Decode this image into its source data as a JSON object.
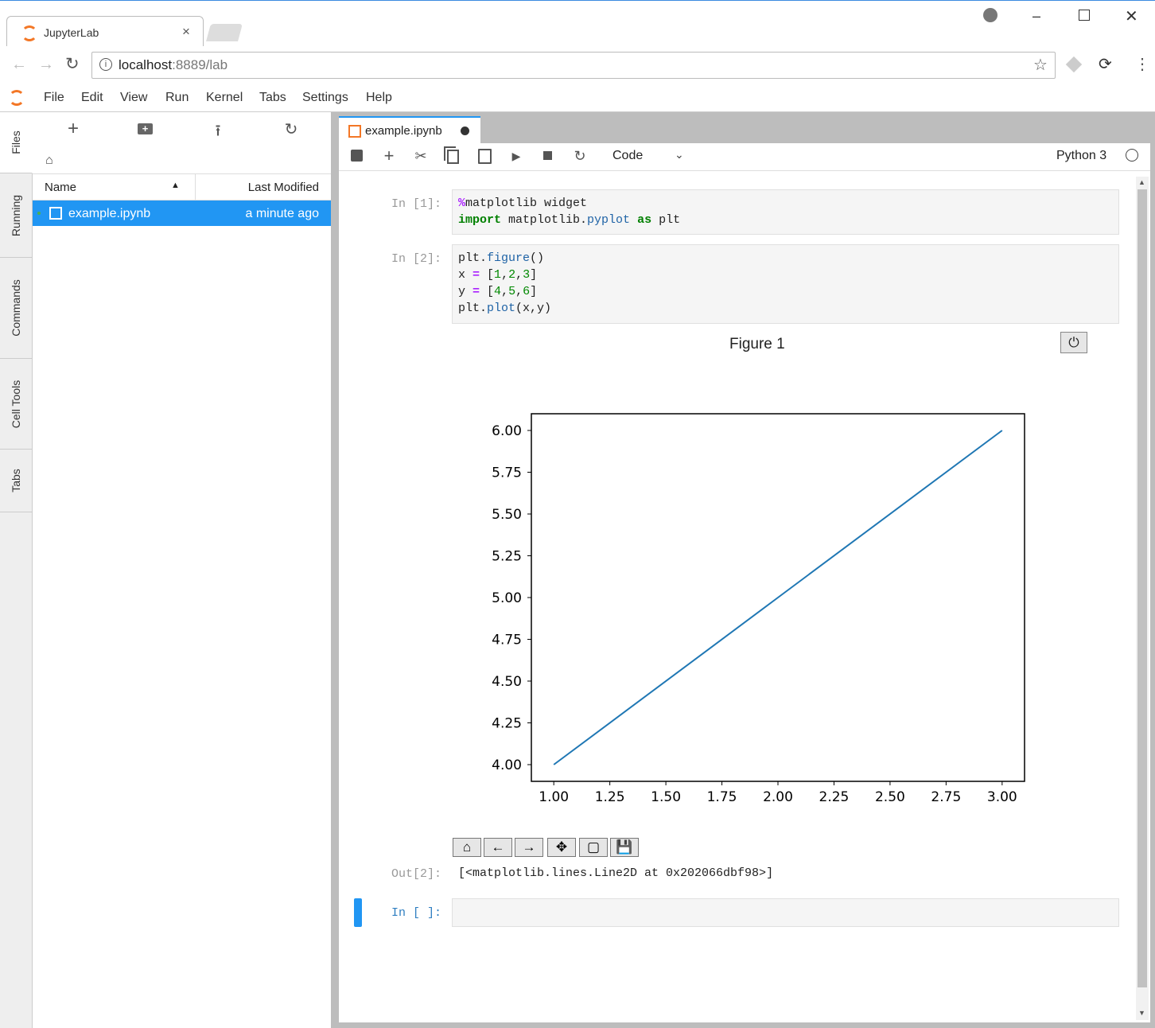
{
  "browser": {
    "tab_title": "JupyterLab",
    "tab_close": "×",
    "url_host": "localhost",
    "url_rest": ":8889/lab"
  },
  "menu": [
    "File",
    "Edit",
    "View",
    "Run",
    "Kernel",
    "Tabs",
    "Settings",
    "Help"
  ],
  "sidebar_tabs": [
    "Files",
    "Running",
    "Commands",
    "Cell Tools",
    "Tabs"
  ],
  "filebrowser": {
    "col_name": "Name",
    "col_modified": "Last Modified",
    "files": [
      {
        "name": "example.ipynb",
        "modified": "a minute ago"
      }
    ]
  },
  "notebook": {
    "tab_title": "example.ipynb",
    "cell_type": "Code",
    "kernel": "Python 3",
    "cells": [
      {
        "prompt": "In [1]:"
      },
      {
        "prompt": "In [2]:"
      },
      {
        "prompt": "Out[2]:",
        "output": "[<matplotlib.lines.Line2D at 0x202066dbf98>]"
      },
      {
        "prompt": "In [ ]:"
      }
    ],
    "figure_title": "Figure 1"
  },
  "chart_data": {
    "type": "line",
    "x": [
      1,
      2,
      3
    ],
    "series": [
      {
        "values": [
          4,
          5,
          6
        ],
        "color": "#1f77b4"
      }
    ],
    "xlim": [
      0.9,
      3.1
    ],
    "ylim": [
      3.9,
      6.1
    ],
    "xticks": [
      "1.00",
      "1.25",
      "1.50",
      "1.75",
      "2.00",
      "2.25",
      "2.50",
      "2.75",
      "3.00"
    ],
    "yticks": [
      "4.00",
      "4.25",
      "4.50",
      "4.75",
      "5.00",
      "5.25",
      "5.50",
      "5.75",
      "6.00"
    ],
    "title": "Figure 1",
    "xlabel": "",
    "ylabel": "",
    "grid": false
  }
}
